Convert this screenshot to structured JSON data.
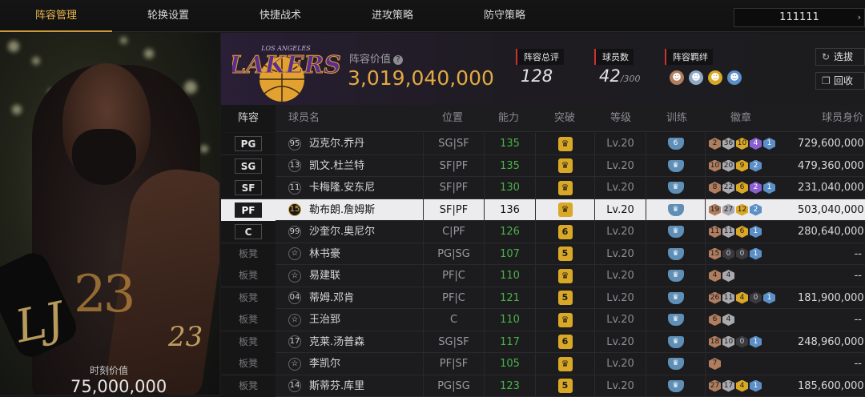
{
  "nav": {
    "tabs": [
      "阵容管理",
      "轮换设置",
      "快捷战术",
      "进攻策略",
      "防守策略"
    ],
    "active_tab": "阵容管理",
    "team_selector": "111111"
  },
  "portrait": {
    "jersey_number": "23",
    "signature": "LJ",
    "signature_number": "23",
    "value_label": "时刻价值",
    "value": "75,000,000"
  },
  "header": {
    "logo_text": "LAKERS",
    "logo_subtext": "LOS ANGELES",
    "roster_value_label": "阵容价值",
    "roster_value": "3,019,040,000",
    "overall_label": "阵容总评",
    "overall_value": "128",
    "players_label": "球员数",
    "players_value": "42",
    "players_max": "/300",
    "bonds_label": "阵容羁绊",
    "filter_button": "选拔",
    "recycle_button": "回收"
  },
  "columns": [
    "阵容",
    "球员名",
    "位置",
    "能力",
    "突破",
    "等级",
    "训练",
    "徽章",
    "球员身价"
  ],
  "rows": [
    {
      "pos": "PG",
      "num": "95",
      "name": "迈克尔.乔丹",
      "position": "SG|SF",
      "ability": "135",
      "brk": "crown",
      "level": "Lv.20",
      "train": "6",
      "badges": [
        [
          "2",
          "b-bronze"
        ],
        [
          "36",
          "b-silver"
        ],
        [
          "10",
          "b-gold"
        ],
        [
          "4",
          "b-purple"
        ],
        [
          "1",
          "b-blue"
        ]
      ],
      "value": "729,600,000"
    },
    {
      "pos": "SG",
      "num": "13",
      "name": "凯文.杜兰特",
      "position": "SF|PF",
      "ability": "135",
      "brk": "crown",
      "level": "Lv.20",
      "train": "crown",
      "badges": [
        [
          "10",
          "b-bronze"
        ],
        [
          "20",
          "b-silver"
        ],
        [
          "9",
          "b-gold"
        ],
        [
          "2",
          "b-blue"
        ]
      ],
      "value": "479,360,000"
    },
    {
      "pos": "SF",
      "num": "11",
      "name": "卡梅隆.安东尼",
      "position": "SF|PF",
      "ability": "130",
      "brk": "crown",
      "level": "Lv.20",
      "train": "crown",
      "badges": [
        [
          "8",
          "b-bronze"
        ],
        [
          "22",
          "b-silver"
        ],
        [
          "6",
          "b-gold"
        ],
        [
          "2",
          "b-purple"
        ],
        [
          "1",
          "b-blue"
        ]
      ],
      "value": "231,040,000"
    },
    {
      "pos": "PF",
      "num": "15",
      "name": "勒布朗.詹姆斯",
      "position": "SF|PF",
      "ability": "136",
      "brk": "crown",
      "level": "Lv.20",
      "train": "crown",
      "badges": [
        [
          "19",
          "b-bronze"
        ],
        [
          "27",
          "b-silver"
        ],
        [
          "12",
          "b-gold"
        ],
        [
          "2",
          "b-blue"
        ]
      ],
      "value": "503,040,000",
      "selected": true
    },
    {
      "pos": "C",
      "num": "99",
      "name": "沙奎尔.奥尼尔",
      "position": "C|PF",
      "ability": "126",
      "brk": "6",
      "level": "Lv.20",
      "train": "crown",
      "badges": [
        [
          "11",
          "b-bronze"
        ],
        [
          "11",
          "b-silver"
        ],
        [
          "6",
          "b-gold"
        ],
        [
          "1",
          "b-blue"
        ]
      ],
      "value": "280,640,000"
    },
    {
      "pos": "板凳",
      "num": "☆",
      "name": "林书豪",
      "position": "PG|SG",
      "ability": "107",
      "brk": "5",
      "level": "Lv.20",
      "train": "crown",
      "badges": [
        [
          "15",
          "b-bronze"
        ],
        [
          "0",
          "b-dark"
        ],
        [
          "0",
          "b-dark"
        ],
        [
          "1",
          "b-blue"
        ]
      ],
      "value": "--"
    },
    {
      "pos": "板凳",
      "num": "☆",
      "name": "易建联",
      "position": "PF|C",
      "ability": "110",
      "brk": "crown",
      "level": "Lv.20",
      "train": "crown",
      "badges": [
        [
          "4",
          "b-bronze"
        ],
        [
          "4",
          "b-silver"
        ]
      ],
      "value": "--"
    },
    {
      "pos": "板凳",
      "num": "04",
      "name": "蒂姆.邓肯",
      "position": "PF|C",
      "ability": "121",
      "brk": "5",
      "level": "Lv.20",
      "train": "crown",
      "badges": [
        [
          "26",
          "b-bronze"
        ],
        [
          "11",
          "b-silver"
        ],
        [
          "4",
          "b-gold"
        ],
        [
          "0",
          "b-dark"
        ],
        [
          "1",
          "b-blue"
        ]
      ],
      "value": "181,900,000"
    },
    {
      "pos": "板凳",
      "num": "☆",
      "name": "王治郅",
      "position": "C",
      "ability": "110",
      "brk": "crown",
      "level": "Lv.20",
      "train": "crown",
      "badges": [
        [
          "6",
          "b-bronze"
        ],
        [
          "4",
          "b-silver"
        ]
      ],
      "value": "--"
    },
    {
      "pos": "板凳",
      "num": "17",
      "name": "克莱.汤普森",
      "position": "SG|SF",
      "ability": "117",
      "brk": "6",
      "level": "Lv.20",
      "train": "crown",
      "badges": [
        [
          "18",
          "b-bronze"
        ],
        [
          "10",
          "b-silver"
        ],
        [
          "0",
          "b-dark"
        ],
        [
          "1",
          "b-blue"
        ]
      ],
      "value": "248,960,000"
    },
    {
      "pos": "板凳",
      "num": "☆",
      "name": "李凯尔",
      "position": "PF|SF",
      "ability": "105",
      "brk": "crown",
      "level": "Lv.20",
      "train": "crown",
      "badges": [
        [
          "7",
          "b-bronze"
        ]
      ],
      "value": "--"
    },
    {
      "pos": "板凳",
      "num": "14",
      "name": "斯蒂芬.库里",
      "position": "PG|SG",
      "ability": "123",
      "brk": "5",
      "level": "Lv.20",
      "train": "crown",
      "badges": [
        [
          "27",
          "b-bronze"
        ],
        [
          "17",
          "b-silver"
        ],
        [
          "4",
          "b-gold"
        ],
        [
          "1",
          "b-blue"
        ]
      ],
      "value": "185,600,000"
    }
  ]
}
